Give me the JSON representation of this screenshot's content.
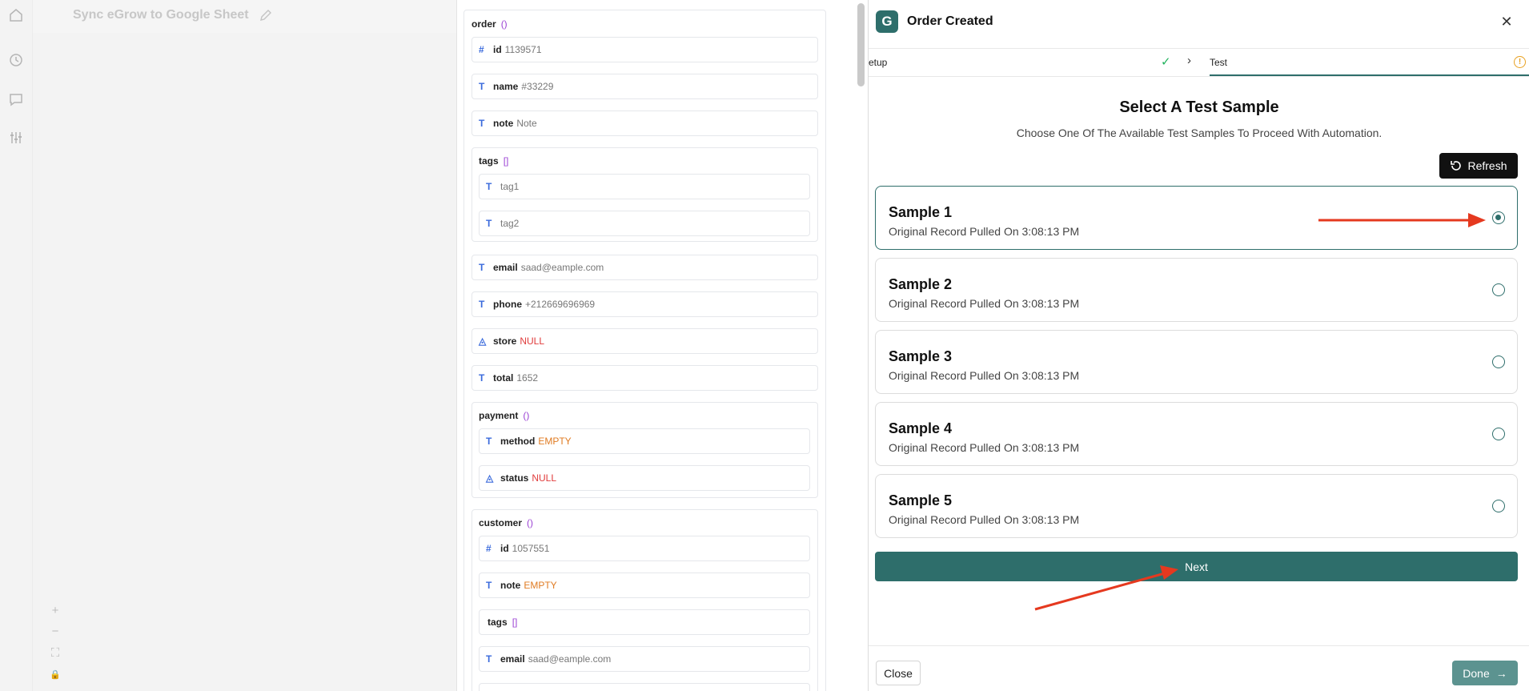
{
  "workflow": {
    "title": "Sync eGrow to Google Sheet"
  },
  "data_panel": {
    "order": {
      "label": "order",
      "bracket": "()"
    },
    "fields": {
      "id": {
        "key": "id",
        "value": "1139571",
        "icon": "#"
      },
      "name": {
        "key": "name",
        "value": "#33229",
        "icon": "T"
      },
      "note": {
        "key": "note",
        "value": "Note",
        "icon": "T"
      },
      "email": {
        "key": "email",
        "value": "saad@eample.com",
        "icon": "T"
      },
      "phone": {
        "key": "phone",
        "value": "+212669696969",
        "icon": "T"
      },
      "store": {
        "key": "store",
        "value": "NULL",
        "icon": "◬"
      },
      "total": {
        "key": "total",
        "value": "1652",
        "icon": "T"
      }
    },
    "tags": {
      "label": "tags",
      "bracket": "[]",
      "items": [
        "tag1",
        "tag2"
      ]
    },
    "payment": {
      "label": "payment",
      "bracket": "()",
      "method": {
        "key": "method",
        "value": "EMPTY"
      },
      "status": {
        "key": "status",
        "value": "NULL"
      }
    },
    "customer": {
      "label": "customer",
      "bracket": "()",
      "id": {
        "key": "id",
        "value": "1057551"
      },
      "note": {
        "key": "note",
        "value": "EMPTY"
      },
      "tags": {
        "label": "tags",
        "bracket": "[]"
      },
      "email": {
        "key": "email",
        "value": "saad@eample.com"
      }
    }
  },
  "right_panel": {
    "title": "Order Created",
    "logo_letter": "G",
    "steps": {
      "setup": "etup",
      "test": "Test"
    },
    "heading": "Select A Test Sample",
    "subheading": "Choose One Of The Available Test Samples To Proceed With Automation.",
    "refresh_label": "Refresh",
    "samples": [
      {
        "name": "Sample 1",
        "desc": "Original Record Pulled On 3:08:13 PM",
        "selected": true
      },
      {
        "name": "Sample 2",
        "desc": "Original Record Pulled On 3:08:13 PM",
        "selected": false
      },
      {
        "name": "Sample 3",
        "desc": "Original Record Pulled On 3:08:13 PM",
        "selected": false
      },
      {
        "name": "Sample 4",
        "desc": "Original Record Pulled On 3:08:13 PM",
        "selected": false
      },
      {
        "name": "Sample 5",
        "desc": "Original Record Pulled On 3:08:13 PM",
        "selected": false
      }
    ],
    "next_label": "Next",
    "close_label": "Close",
    "done_label": "Done"
  },
  "colors": {
    "accent": "#2e6e6b",
    "annotation_arrow": "#e5391f",
    "null": "#e03b3b",
    "empty": "#e07b22"
  }
}
